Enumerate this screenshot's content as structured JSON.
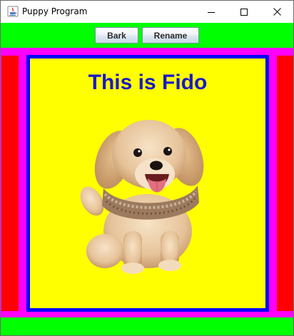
{
  "window": {
    "title": "Puppy Program",
    "icon": "java-cup-icon",
    "controls": [
      "minimize-icon",
      "maximize-icon",
      "close-icon"
    ]
  },
  "toolbar": {
    "bark_label": "Bark",
    "rename_label": "Rename"
  },
  "panel": {
    "title": "This is Fido",
    "image": "puppy-image"
  },
  "colors": {
    "toolbar_bg": "#00ff00",
    "border_magenta": "#ff00ff",
    "side_red": "#ff0000",
    "frame_blue": "#0000ff",
    "panel_yellow": "#ffff00",
    "title_text": "#1919c8"
  }
}
